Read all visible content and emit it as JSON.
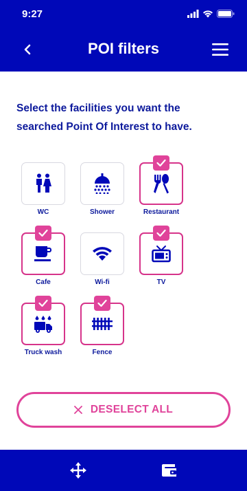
{
  "status_bar": {
    "time": "9:27"
  },
  "header": {
    "title": "POI filters"
  },
  "intro_text": "Select the facilities you want the searched Point Of Interest to have.",
  "facilities": [
    {
      "label": "WC",
      "icon": "wc-icon",
      "selected": false
    },
    {
      "label": "Shower",
      "icon": "shower-icon",
      "selected": false
    },
    {
      "label": "Restaurant",
      "icon": "restaurant-icon",
      "selected": true
    },
    {
      "label": "Cafe",
      "icon": "cafe-icon",
      "selected": true
    },
    {
      "label": "Wi-fi",
      "icon": "wifi-icon",
      "selected": false
    },
    {
      "label": "TV",
      "icon": "tv-icon",
      "selected": true
    },
    {
      "label": "Truck wash",
      "icon": "truck-wash-icon",
      "selected": true
    },
    {
      "label": "Fence",
      "icon": "fence-icon",
      "selected": true
    }
  ],
  "deselect_label": "DESELECT ALL",
  "footer": {
    "left_icon": "move-icon",
    "right_icon": "wallet-icon"
  },
  "colors": {
    "primary": "#0008b8",
    "accent": "#e0439a",
    "text": "#0d1a9c"
  }
}
